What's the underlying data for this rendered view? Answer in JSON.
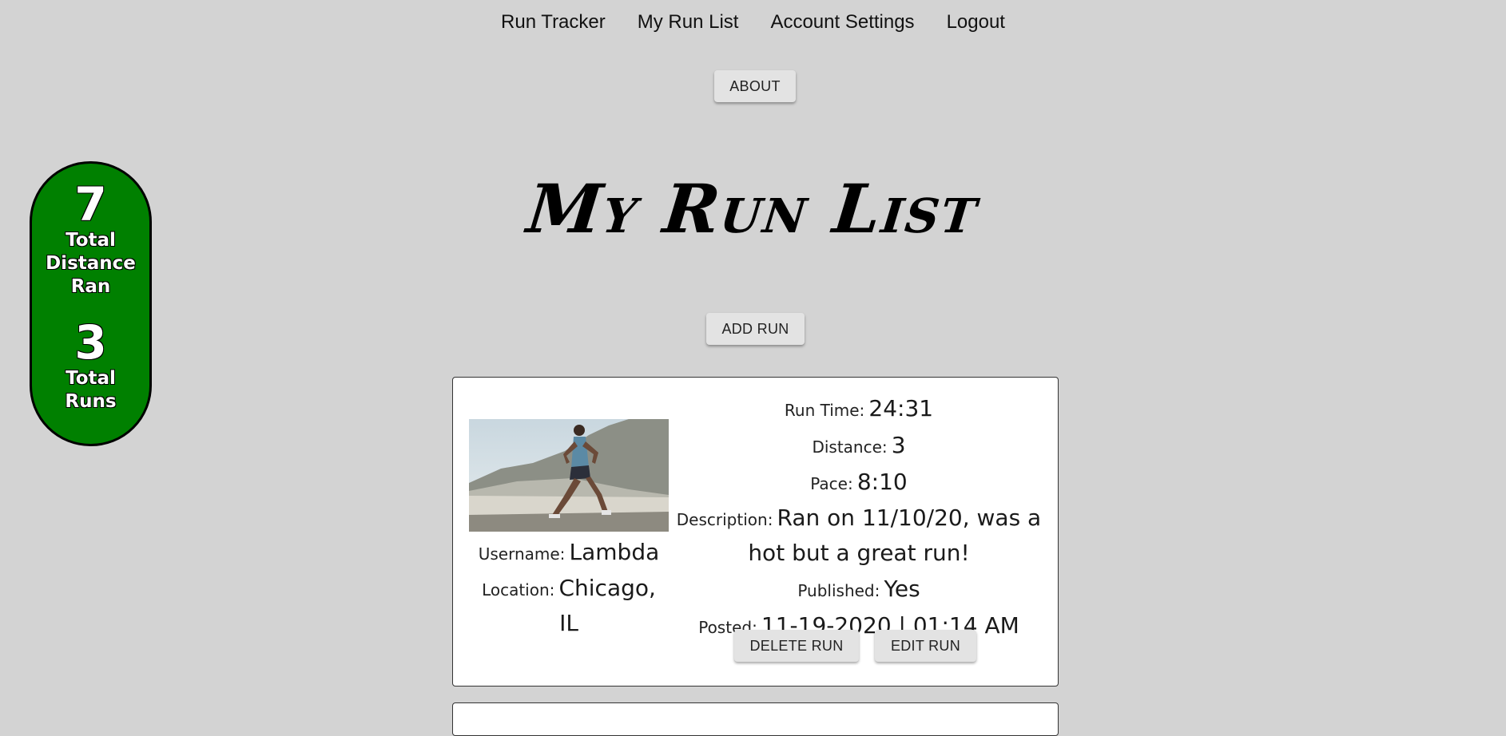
{
  "nav": {
    "items": [
      "Run Tracker",
      "My Run List",
      "Account Settings",
      "Logout"
    ]
  },
  "about_label": "ABOUT",
  "page_title": "My Run List",
  "add_run_label": "ADD RUN",
  "stats": {
    "distance_value": "7",
    "distance_label": "Total Distance Ran",
    "runs_value": "3",
    "runs_label": "Total Runs",
    "color": "#008000"
  },
  "run": {
    "username_label": "Username:",
    "username": "Lambda",
    "location_label": "Location:",
    "location": "Chicago, IL",
    "run_time_label": "Run Time:",
    "run_time": "24:31",
    "distance_label": "Distance:",
    "distance": "3",
    "pace_label": "Pace:",
    "pace": "8:10",
    "description_label": "Description:",
    "description": "Ran on 11/10/20, was a hot but a great run!",
    "published_label": "Published:",
    "published": "Yes",
    "posted_label": "Posted:",
    "posted": "11-19-2020 | 01:14 AM",
    "delete_label": "DELETE RUN",
    "edit_label": "EDIT RUN"
  }
}
